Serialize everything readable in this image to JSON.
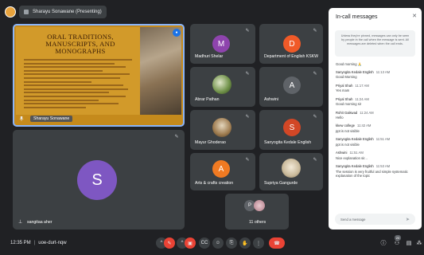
{
  "presenting_label": "Sharayu Sonawane (Presenting)",
  "slide": {
    "title": "ORAL TRADITIONS, MANUSCRIPTS, AND MONOGRAPHS",
    "presenter_name": "Sharayu Sonawane"
  },
  "tiles": [
    {
      "name": "Madhuri Shelar",
      "initial": "M",
      "color": "#8e44ad"
    },
    {
      "name": "Department of English KSKW",
      "initial": "D",
      "color": "#f05a28"
    },
    {
      "name": "Abrar Pathan",
      "initial": "",
      "color": "#6d8f46"
    },
    {
      "name": "Ashwini",
      "initial": "A",
      "color": "#5f6368"
    },
    {
      "name": "Mayur Ghoderao",
      "initial": "",
      "color": "#9e7b4f"
    },
    {
      "name": "Sanyogita Kedale English",
      "initial": "S",
      "color": "#d24726"
    },
    {
      "name": "Arts & crafts creation",
      "initial": "A",
      "color": "#f07a22"
    },
    {
      "name": "Supriya Gangurde",
      "initial": "",
      "color": "#c9b99a"
    }
  ],
  "large_tile": {
    "name": "sangitaa aher",
    "initial": "S",
    "color": "#7e57c2"
  },
  "others": {
    "label": "11 others",
    "initial": "P"
  },
  "meeting": {
    "time": "12:35 PM",
    "code": "uoe-durt-nqw",
    "participant_count": "20"
  },
  "chat": {
    "title": "In-call messages",
    "notice": "Unless they're pinned, messages can only be seen by people in the call when the message is sent. All messages are deleted when the call ends.",
    "messages": [
      {
        "who": "",
        "time": "",
        "text": "Good morning 🙏"
      },
      {
        "who": "Sanyogita Kedale English",
        "time": "11:13 AM",
        "text": "Good Morning"
      },
      {
        "who": "Priyal Shah",
        "time": "11:17 AM",
        "text": "Yes mam"
      },
      {
        "who": "Priyal Shah",
        "time": "11:24 AM",
        "text": "Good morning sir"
      },
      {
        "who": "Rohit Gaikwad",
        "time": "11:24 AM",
        "text": "Hello"
      },
      {
        "who": "kkew college",
        "time": "11:42 AM",
        "text": "ppt is not visible"
      },
      {
        "who": "Sanyogita Kedale English",
        "time": "11:51 AM",
        "text": "ppt is not visible"
      },
      {
        "who": "Ashwini",
        "time": "11:51 AM",
        "text": "Nice explanation sir..."
      },
      {
        "who": "Sanyogita Kedale English",
        "time": "11:53 AM",
        "text": "The session is very fruitful and simple systematic explanation of the topic"
      }
    ],
    "placeholder": "Send a message"
  }
}
